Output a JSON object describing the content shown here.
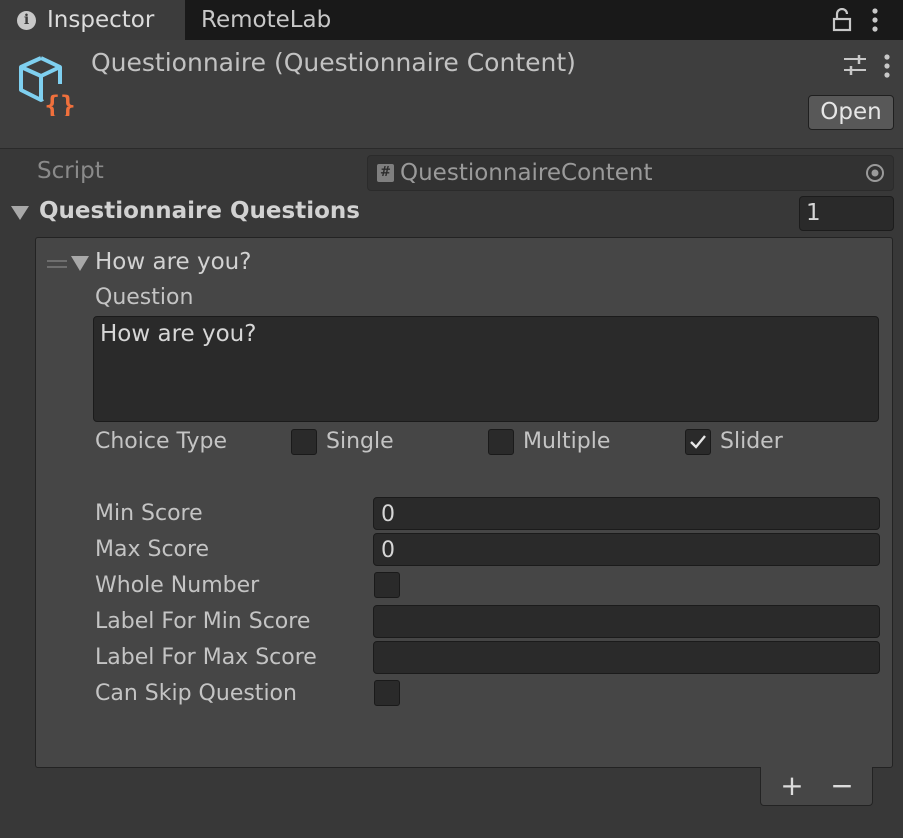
{
  "tabs": [
    {
      "label": "Inspector",
      "icon": "info-icon"
    },
    {
      "label": "RemoteLab"
    }
  ],
  "tab_icons": {
    "info": "i"
  },
  "header": {
    "title": "Questionnaire (Questionnaire Content)",
    "open_label": "Open",
    "icon": "script-asset-icon"
  },
  "script": {
    "label": "Script",
    "value": "QuestionnaireContent",
    "hash": "#"
  },
  "list": {
    "title": "Questionnaire Questions",
    "size": "1"
  },
  "element": {
    "title": "How are you?",
    "question_label": "Question",
    "question_value": "How are you?",
    "choice_type_label": "Choice Type",
    "choices": [
      {
        "label": "Single",
        "checked": false
      },
      {
        "label": "Multiple",
        "checked": false
      },
      {
        "label": "Slider",
        "checked": true
      }
    ],
    "min_score_label": "Min Score",
    "min_score_value": "0",
    "max_score_label": "Max Score",
    "max_score_value": "0",
    "whole_number_label": "Whole Number",
    "whole_number_checked": false,
    "label_min_label": "Label For Min Score",
    "label_min_value": "",
    "label_max_label": "Label For Max Score",
    "label_max_value": "",
    "can_skip_label": "Can Skip Question",
    "can_skip_checked": false
  },
  "footer": {
    "add": "+",
    "remove": "−"
  },
  "colors": {
    "background": "#383838",
    "tabbar": "#191919",
    "field": "#2a2a2a",
    "icon_blue": "#7fd0f0",
    "icon_orange": "#f0703c"
  }
}
